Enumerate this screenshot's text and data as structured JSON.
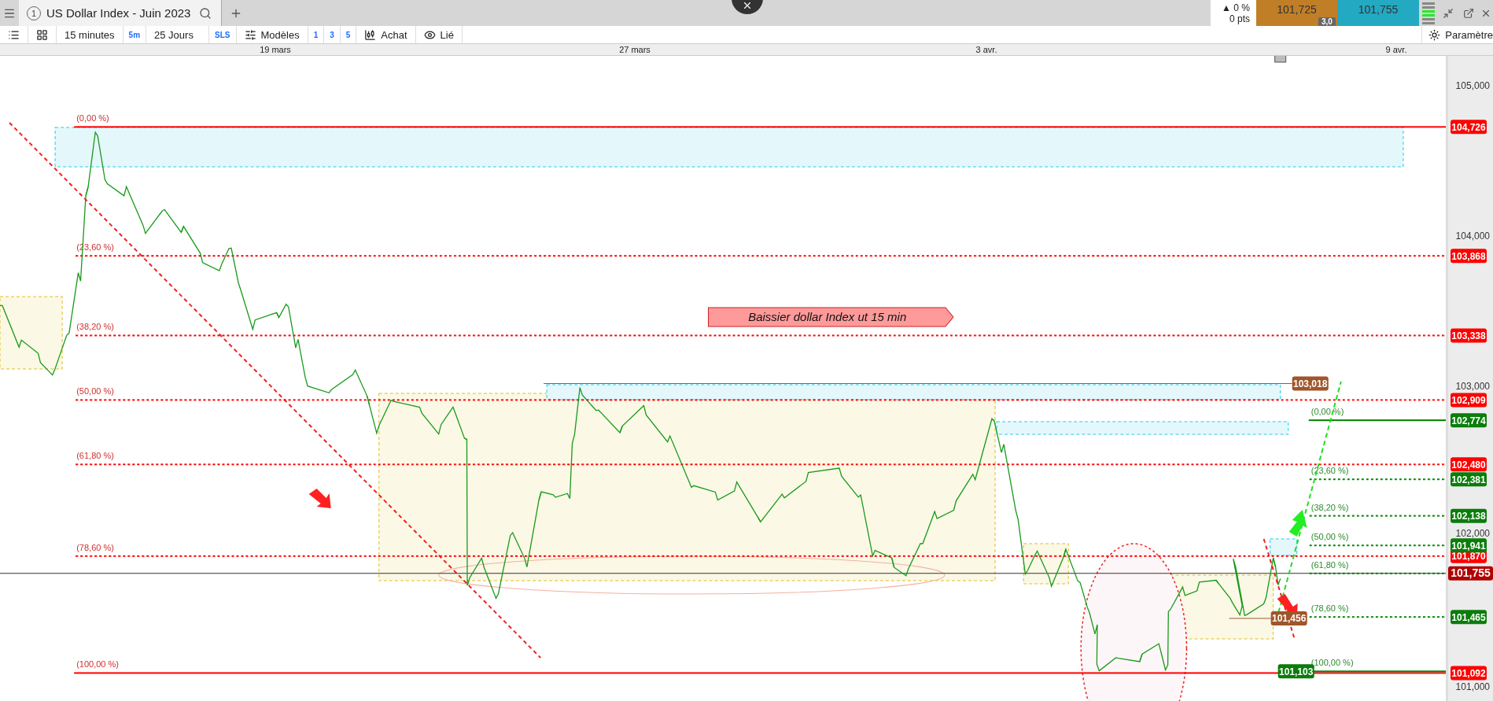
{
  "tab_bar": {
    "tabs": [
      {
        "number": "1",
        "title": "US Dollar Index - Juin 2023",
        "selected": true
      }
    ],
    "quote": {
      "arrow": "▲",
      "change": "0 %",
      "points": "0 pts",
      "bid": "101,725",
      "ask": "101,755",
      "spread": "3,0"
    }
  },
  "toolbar": {
    "items": [
      {
        "kind": "plain",
        "label": "15 minutes"
      },
      {
        "kind": "accent",
        "label": "5m"
      },
      {
        "kind": "plain",
        "label": "25 Jours"
      },
      {
        "kind": "accent",
        "label": "SLS"
      },
      {
        "kind": "tool",
        "label": "Modèles"
      },
      {
        "kind": "accent",
        "label": "1"
      },
      {
        "kind": "accent",
        "label": "3"
      },
      {
        "kind": "accent",
        "label": "5"
      },
      {
        "kind": "tool",
        "label": "Achat"
      },
      {
        "kind": "tool",
        "label": "Lié"
      }
    ],
    "settings": "Paramètre"
  },
  "chart": {
    "dates": [
      "19 mars",
      "27 mars",
      "3 avr.",
      "9 avr."
    ],
    "price_ticks": [
      "105,000",
      "104,000",
      "103,000",
      "102,000",
      "101,000"
    ],
    "annotation": "Baissier dollar Index ut 15 min",
    "left_fib": [
      {
        "kind": "axis",
        "label": "(0,00 %)",
        "price": "104,726",
        "dotted": false
      },
      {
        "kind": "axis",
        "label": "(23,60 %)",
        "price": "103,868",
        "dotted": true
      },
      {
        "kind": "axis",
        "label": "(38,20 %)",
        "price": "103,338",
        "dotted": true
      },
      {
        "kind": "axis",
        "label": "(50,00 %)",
        "price": "102,909",
        "dotted": true
      },
      {
        "kind": "axis",
        "label": "(61,80 %)",
        "price": "102,480",
        "dotted": true
      },
      {
        "kind": "axis",
        "label": "(78,60 %)",
        "price": "101,870",
        "dotted": true
      },
      {
        "kind": "axis",
        "label": "(100,00 %)",
        "price": "101,092",
        "dotted": false
      }
    ],
    "right_fib": [
      {
        "kind": "axis",
        "label": "(0,00 %)",
        "price": "102,774",
        "dotted": false
      },
      {
        "kind": "axis",
        "label": "(23,60 %)",
        "price": "102,381",
        "dotted": true
      },
      {
        "kind": "axis",
        "label": "(38,20 %)",
        "price": "102,138",
        "dotted": true
      },
      {
        "kind": "axis",
        "label": "(50,00 %)",
        "price": "101,941",
        "dotted": true
      },
      {
        "kind": "last",
        "label": "(61,80 %)",
        "dotted": true
      },
      {
        "kind": "axis",
        "label": "(78,60 %)",
        "price": "101,465",
        "dotted": true
      },
      {
        "kind": "inline",
        "label": "(100,00 %)",
        "price": "101,103",
        "dotted": false
      }
    ],
    "markers": [
      {
        "price": "103,018"
      },
      {
        "price": "101,456"
      }
    ],
    "last_price": "101,755"
  }
}
